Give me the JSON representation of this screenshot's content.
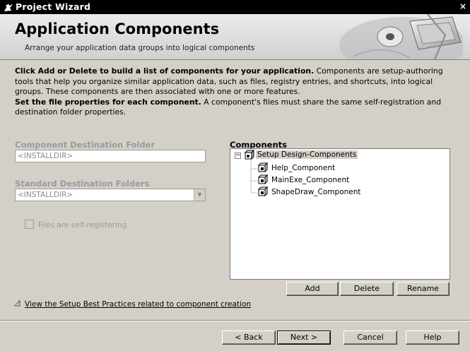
{
  "window": {
    "title": "Project Wizard",
    "close_glyph": "×"
  },
  "banner": {
    "heading": "Application Components",
    "subtitle": "Arrange your application data groups into logical components"
  },
  "intro": {
    "p1_bold": "Click Add or Delete to build a list of components for your application.",
    "p1_rest": " Components are setup-authoring tools that help you organize similar application data, such as files, registry entries, and shortcuts, into logical groups. These components are then associated with one or more features.",
    "p2_bold": "Set the file properties for each component.",
    "p2_rest": " A component's files must share the same self-registration and destination folder properties."
  },
  "component_destination": {
    "label": "Component Destination Folder",
    "value": "<INSTALLDIR>"
  },
  "standard_destination": {
    "label": "Standard Destination Folders",
    "value": "<INSTALLDIR>"
  },
  "self_register": {
    "label": "Files are self-registering",
    "checked": false
  },
  "components": {
    "label": "Components",
    "root": "Setup Design-Components",
    "items": [
      "Help_Component",
      "MainExe_Component",
      "ShapeDraw_Component"
    ],
    "buttons": {
      "add": "Add",
      "delete": "Delete",
      "rename": "Rename"
    }
  },
  "link": {
    "text": "View the Setup Best Practices related to component creation"
  },
  "footer": {
    "back": "< Back",
    "next": "Next >",
    "cancel": "Cancel",
    "help": "Help"
  }
}
